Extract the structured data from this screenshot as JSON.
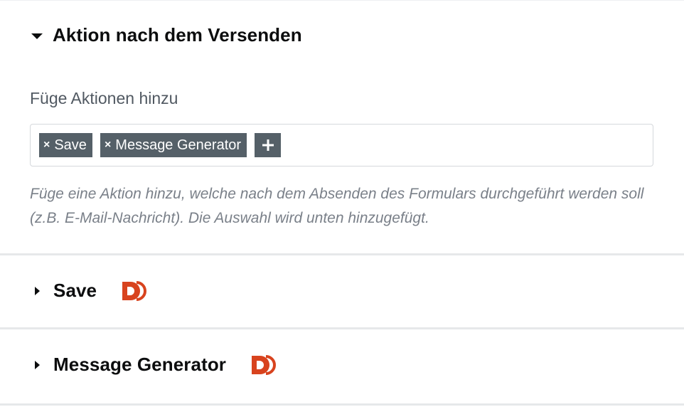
{
  "colors": {
    "accent_logo": "#d8431e",
    "tag_bg": "#556068",
    "help_text": "#7a8089"
  },
  "sections": {
    "after_submit": {
      "title": "Aktion nach dem Versenden",
      "expanded": true,
      "field_label": "Füge Aktionen hinzu",
      "tags": [
        {
          "remove_label": "×",
          "label": "Save"
        },
        {
          "remove_label": "×",
          "label": "Message Generator"
        }
      ],
      "add_icon": "plus-icon",
      "help_text": "Füge eine Aktion hinzu, welche nach dem Absenden des Formulars durchgeführt werden soll (z.B. E-Mail-Nachricht). Die Auswahl wird unten hinzugefügt."
    },
    "save": {
      "title": "Save",
      "expanded": false,
      "icon": "dynamic-content-logo-icon"
    },
    "message_generator": {
      "title": "Message Generator",
      "expanded": false,
      "icon": "dynamic-content-logo-icon"
    }
  }
}
